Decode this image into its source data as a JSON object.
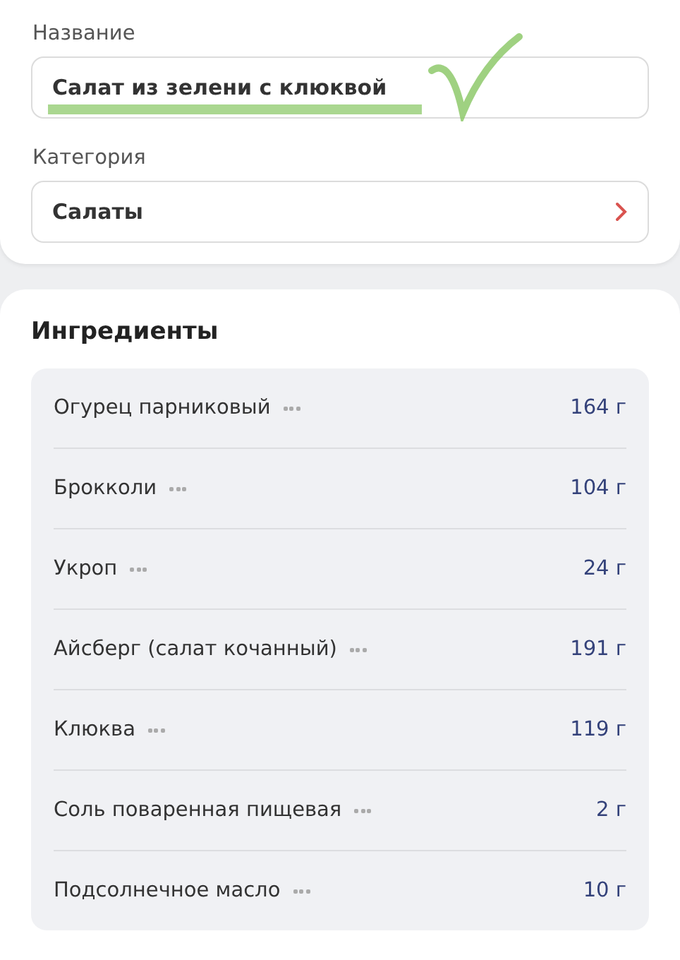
{
  "name_field": {
    "label": "Название",
    "value": "Салат из зелени с клюквой",
    "highlighted": true
  },
  "category_field": {
    "label": "Категория",
    "value": "Салаты"
  },
  "ingredients": {
    "title": "Ингредиенты",
    "items": [
      {
        "name": "Огурец парниковый",
        "amount": "164 г"
      },
      {
        "name": "Брокколи",
        "amount": "104 г"
      },
      {
        "name": "Укроп",
        "amount": "24 г"
      },
      {
        "name": "Айсберг (салат кочанный)",
        "amount": "191 г"
      },
      {
        "name": "Клюква",
        "amount": "119 г"
      },
      {
        "name": "Соль поваренная пищевая",
        "amount": "2 г"
      },
      {
        "name": "Подсолнечное масло",
        "amount": "10 г"
      }
    ]
  }
}
